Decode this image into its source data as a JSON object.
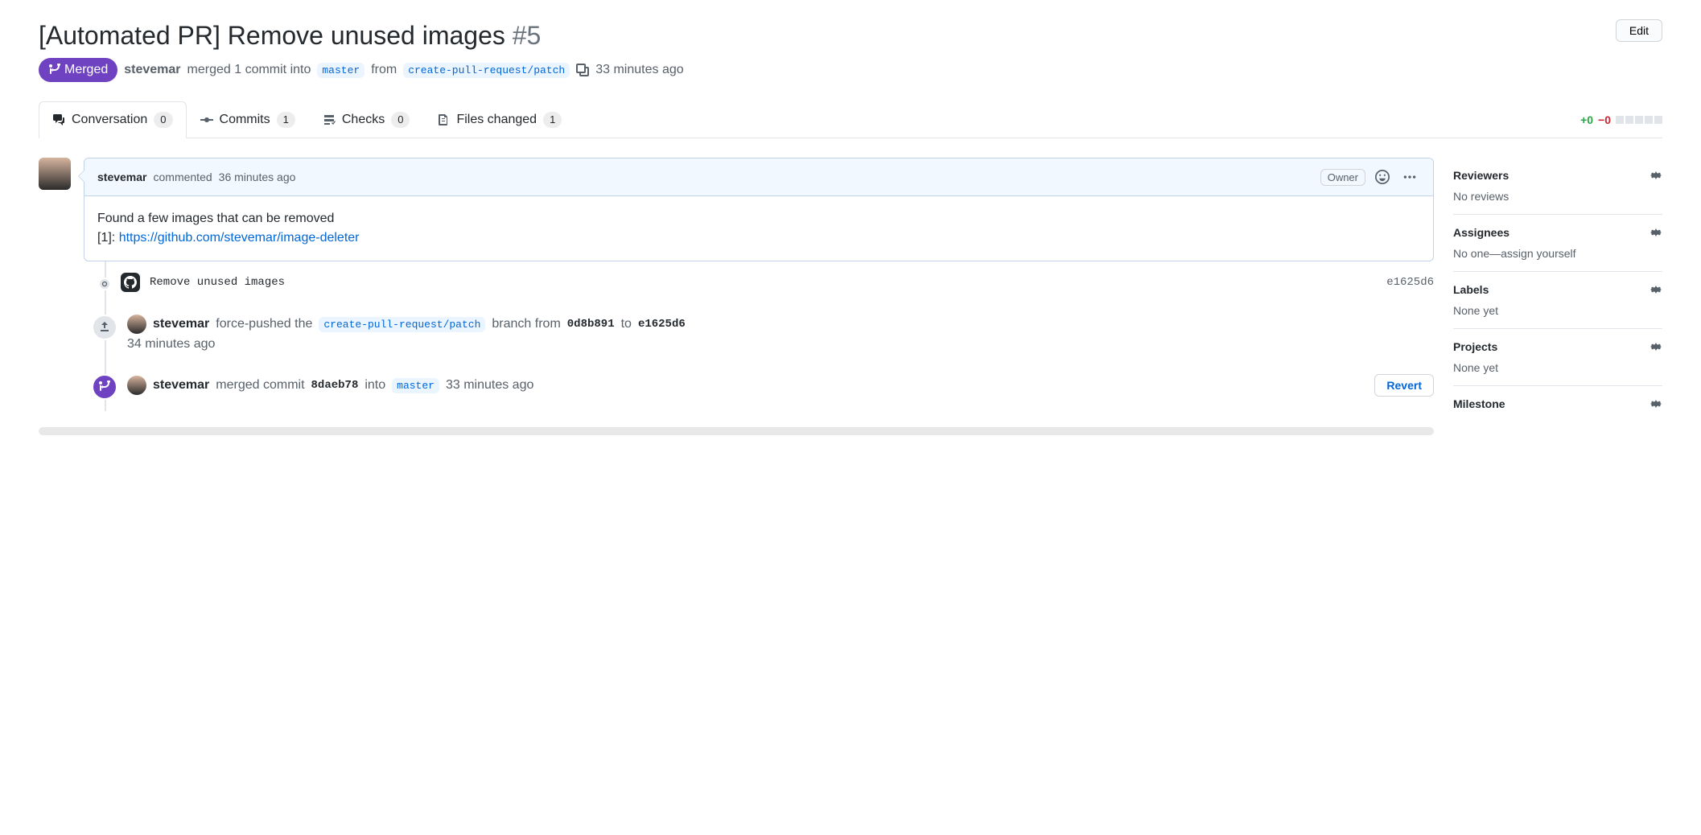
{
  "header": {
    "title": "[Automated PR] Remove unused images",
    "number": "#5",
    "edit": "Edit",
    "state": "Merged",
    "author": "stevemar",
    "merge_verb": "merged 1 commit into",
    "into_branch": "master",
    "from_word": "from",
    "from_branch": "create-pull-request/patch",
    "time": "33 minutes ago"
  },
  "tabs": {
    "conversation": {
      "label": "Conversation",
      "count": "0"
    },
    "commits": {
      "label": "Commits",
      "count": "1"
    },
    "checks": {
      "label": "Checks",
      "count": "0"
    },
    "files": {
      "label": "Files changed",
      "count": "1"
    },
    "diff_add": "+0",
    "diff_del": "−0"
  },
  "comment": {
    "author": "stevemar",
    "verb": "commented",
    "time": "36 minutes ago",
    "owner": "Owner",
    "body_line1": "Found a few images that can be removed",
    "body_prefix": "[1]: ",
    "body_link": "https://github.com/stevemar/image-deleter"
  },
  "timeline": {
    "commit_msg": "Remove unused images",
    "commit_sha": "e1625d6",
    "forcepush": {
      "author": "stevemar",
      "text1": "force-pushed the",
      "branch": "create-pull-request/patch",
      "text2": "branch from",
      "sha_old": "0d8b891",
      "to": "to",
      "sha_new": "e1625d6",
      "time": "34 minutes ago"
    },
    "merge": {
      "author": "stevemar",
      "text1": "merged commit",
      "sha": "8daeb78",
      "into": "into",
      "branch": "master",
      "time": "33 minutes ago",
      "revert": "Revert"
    }
  },
  "sidebar": {
    "reviewers": {
      "title": "Reviewers",
      "body": "No reviews"
    },
    "assignees": {
      "title": "Assignees",
      "body": "No one—assign yourself"
    },
    "labels": {
      "title": "Labels",
      "body": "None yet"
    },
    "projects": {
      "title": "Projects",
      "body": "None yet"
    },
    "milestone": {
      "title": "Milestone"
    }
  }
}
